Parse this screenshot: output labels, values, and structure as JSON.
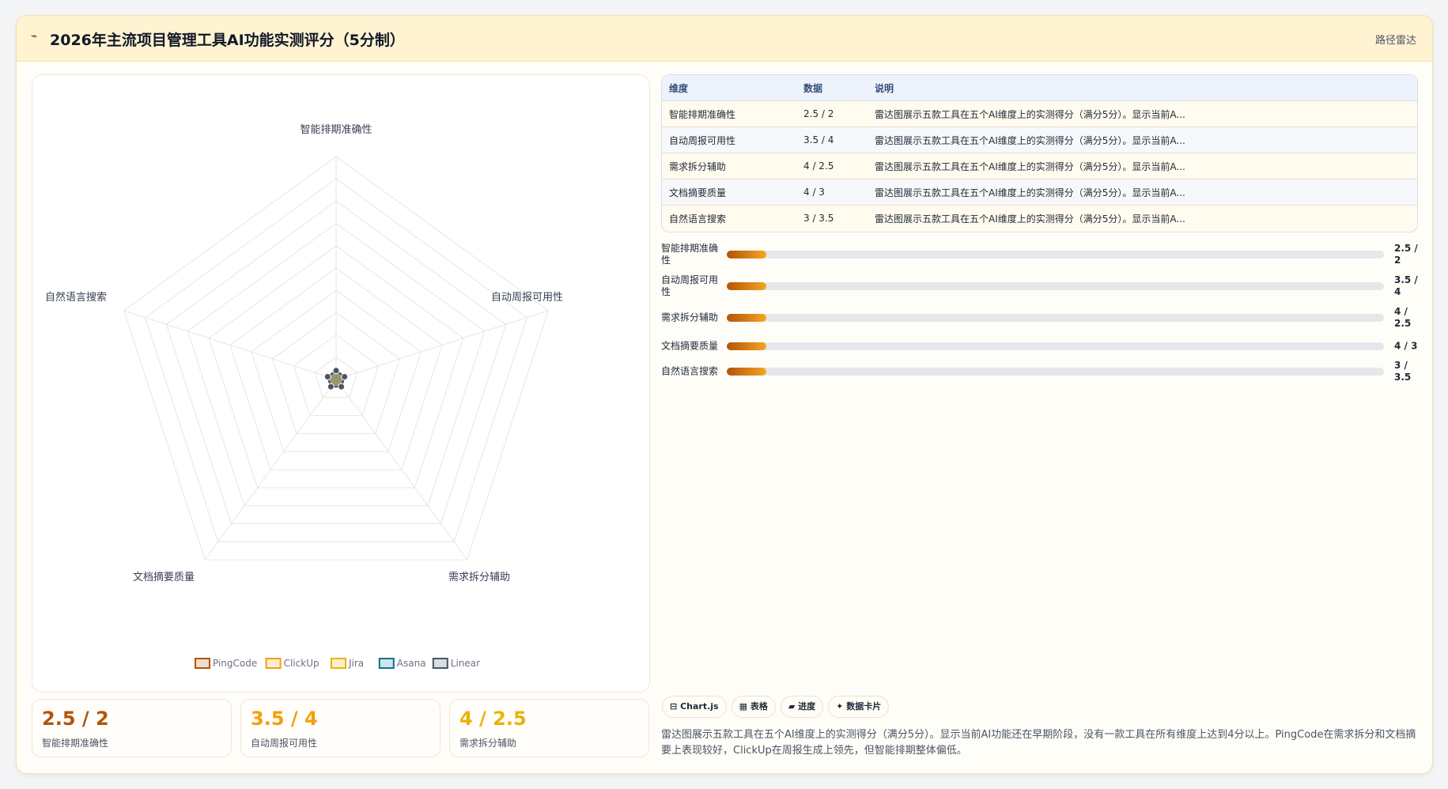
{
  "header": {
    "logo_glyph": "⌁",
    "title": "2026年主流项目管理工具AI功能实测评分（5分制）",
    "mode_label": "路径雷达"
  },
  "chart_data": {
    "type": "radar",
    "axes": [
      "智能排期准确性",
      "自动周报可用性",
      "需求拆分辅助",
      "文档摘要质量",
      "自然语言搜索"
    ],
    "series": [
      {
        "name": "PingCode",
        "values": [
          0.2,
          0.2,
          0.2,
          0.2,
          0.2
        ],
        "color": "#b45309"
      },
      {
        "name": "ClickUp",
        "values": [
          0.2,
          0.2,
          0.2,
          0.2,
          0.2
        ],
        "color": "#f59e0b"
      },
      {
        "name": "Jira",
        "values": [
          0.2,
          0.2,
          0.2,
          0.2,
          0.2
        ],
        "color": "#eab308"
      },
      {
        "name": "Asana",
        "values": [
          0.2,
          0.2,
          0.2,
          0.2,
          0.2
        ],
        "color": "#0e7490"
      },
      {
        "name": "Linear",
        "values": [
          0.2,
          0.2,
          0.2,
          0.2,
          0.2
        ],
        "color": "#475569"
      }
    ],
    "rmax": 5,
    "rings": 10,
    "legend_position": "bottom"
  },
  "kpis": [
    {
      "value": "2.5 / 2",
      "label": "智能排期准确性",
      "color": "#b45309"
    },
    {
      "value": "3.5 / 4",
      "label": "自动周报可用性",
      "color": "#f59e0b"
    },
    {
      "value": "4 / 2.5",
      "label": "需求拆分辅助",
      "color": "#eab308"
    }
  ],
  "table": {
    "headers": [
      "维度",
      "数据",
      "说明"
    ],
    "rows": [
      {
        "dim": "智能排期准确性",
        "data": "2.5 / 2",
        "note": "雷达图展示五款工具在五个AI维度上的实测得分（满分5分）。显示当前A..."
      },
      {
        "dim": "自动周报可用性",
        "data": "3.5 / 4",
        "note": "雷达图展示五款工具在五个AI维度上的实测得分（满分5分）。显示当前A..."
      },
      {
        "dim": "需求拆分辅助",
        "data": "4 / 2.5",
        "note": "雷达图展示五款工具在五个AI维度上的实测得分（满分5分）。显示当前A..."
      },
      {
        "dim": "文档摘要质量",
        "data": "4 / 3",
        "note": "雷达图展示五款工具在五个AI维度上的实测得分（满分5分）。显示当前A..."
      },
      {
        "dim": "自然语言搜索",
        "data": "3 / 3.5",
        "note": "雷达图展示五款工具在五个AI维度上的实测得分（满分5分）。显示当前A..."
      }
    ]
  },
  "progress": [
    {
      "label": "智能排期准确性",
      "value": "2.5 / 2",
      "fraction": 0.06
    },
    {
      "label": "自动周报可用性",
      "value": "3.5 / 4",
      "fraction": 0.06
    },
    {
      "label": "需求拆分辅助",
      "value": "4 / 2.5",
      "fraction": 0.06
    },
    {
      "label": "文档摘要质量",
      "value": "4 / 3",
      "fraction": 0.06
    },
    {
      "label": "自然语言搜索",
      "value": "3 / 3.5",
      "fraction": 0.06
    }
  ],
  "chips": [
    {
      "icon": "⊟",
      "label": "Chart.js"
    },
    {
      "icon": "▦",
      "label": "表格"
    },
    {
      "icon": "▰",
      "label": "进度"
    },
    {
      "icon": "✦",
      "label": "数据卡片"
    }
  ],
  "description": "雷达图展示五款工具在五个AI维度上的实测得分（满分5分）。显示当前AI功能还在早期阶段，没有一款工具在所有维度上达到4分以上。PingCode在需求拆分和文档摘要上表现较好，ClickUp在周报生成上领先，但智能排期整体偏低。"
}
